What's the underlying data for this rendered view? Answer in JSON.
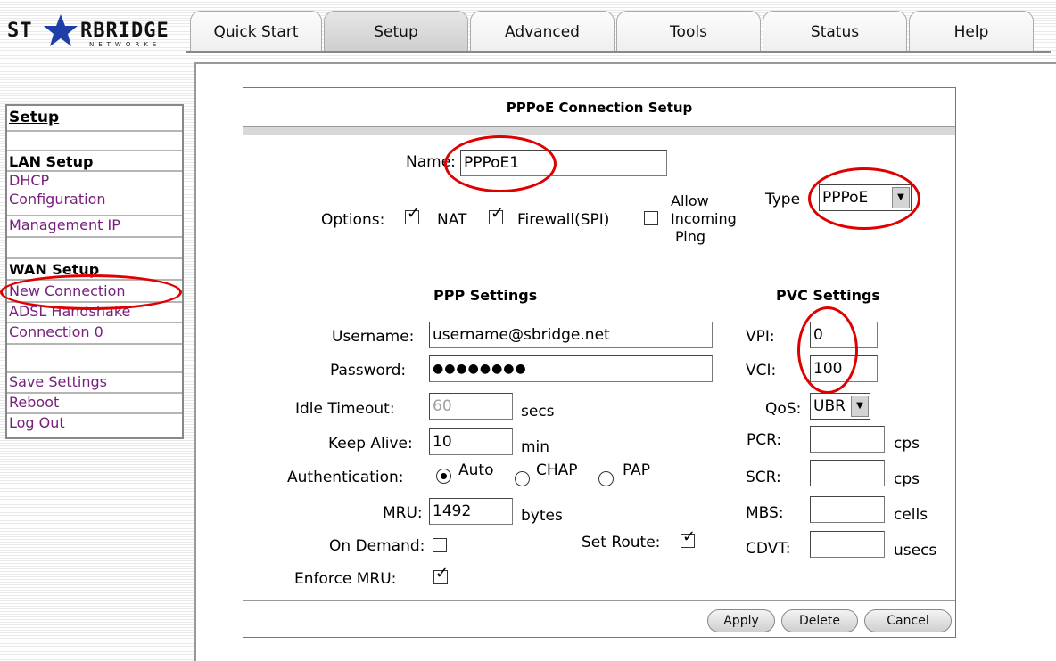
{
  "logo": {
    "text_left": "ST",
    "text_right": "RBRIDGE",
    "subtext": "NETWORKS"
  },
  "tabs": [
    "Quick Start",
    "Setup",
    "Advanced",
    "Tools",
    "Status",
    "Help"
  ],
  "active_tab": "Setup",
  "sidebar": {
    "title": "Setup",
    "lan_header": "LAN Setup",
    "dhcp_1": "DHCP",
    "dhcp_2": "Configuration",
    "management_ip": "Management IP",
    "wan_header": "WAN Setup",
    "new_connection": "New Connection",
    "adsl_handshake": "ADSL Handshake",
    "connection_0": "Connection 0",
    "save_settings": "Save Settings",
    "reboot": "Reboot",
    "log_out": "Log Out"
  },
  "form": {
    "title": "PPPoE Connection Setup",
    "name_label": "Name:",
    "name_value": "PPPoE1",
    "type_label": "Type",
    "type_value": "PPPoE",
    "options_label": "Options:",
    "opt_nat": "NAT",
    "opt_firewall": "Firewall(SPI)",
    "opt_ping_1": "Allow",
    "opt_ping_2": "Incoming",
    "opt_ping_3": "Ping",
    "ppp_header": "PPP Settings",
    "pvc_header": "PVC Settings",
    "username_label": "Username:",
    "username_value": "username@sbridge.net",
    "password_label": "Password:",
    "password_value": "●●●●●●●●",
    "idle_label": "Idle Timeout:",
    "idle_value": "60",
    "idle_unit": "secs",
    "keepalive_label": "Keep Alive:",
    "keepalive_value": "10",
    "keepalive_unit": "min",
    "auth_label": "Authentication:",
    "auth_auto": "Auto",
    "auth_chap": "CHAP",
    "auth_pap": "PAP",
    "mru_label": "MRU:",
    "mru_value": "1492",
    "mru_unit": "bytes",
    "ondemand_label": "On Demand:",
    "setroute_label": "Set Route:",
    "enforce_label": "Enforce MRU:",
    "vpi_label": "VPI:",
    "vpi_value": "0",
    "vci_label": "VCI:",
    "vci_value": "100",
    "qos_label": "QoS:",
    "qos_value": "UBR",
    "pcr_label": "PCR:",
    "pcr_unit": "cps",
    "scr_label": "SCR:",
    "scr_unit": "cps",
    "mbs_label": "MBS:",
    "mbs_unit": "cells",
    "cdvt_label": "CDVT:",
    "cdvt_unit": "usecs",
    "check_mark": "✓"
  },
  "buttons": {
    "apply": "Apply",
    "delete": "Delete",
    "cancel": "Cancel"
  },
  "colors": {
    "link": "#77207d",
    "annotation": "#e00000",
    "logo_star": "#1f3fa8"
  }
}
